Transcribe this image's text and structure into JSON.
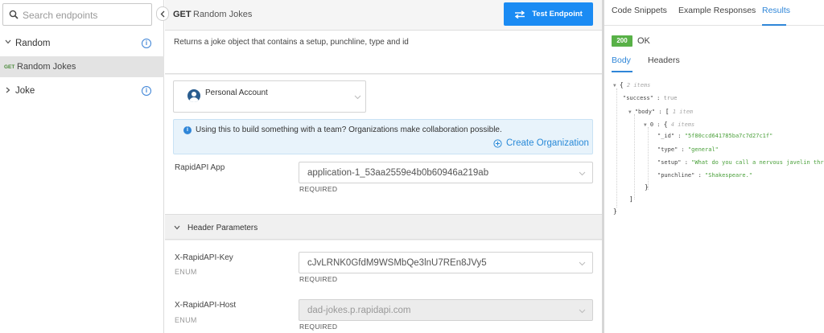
{
  "sidebar": {
    "search_placeholder": "Search endpoints",
    "groups": [
      {
        "label": "Random",
        "info": "i"
      },
      {
        "label": "Joke",
        "info": "i"
      }
    ],
    "endpoint": {
      "method": "GET",
      "name": "Random Jokes"
    }
  },
  "main": {
    "method": "GET",
    "title": "Random Jokes",
    "test_button": "Test Endpoint",
    "description": "Returns a joke object that contains a setup, punchline, type and id",
    "account": "Personal Account",
    "notice": {
      "icon": "i",
      "text": "Using this to build something with a team? Organizations make collaboration possible.",
      "link": "Create Organization"
    },
    "app": {
      "label": "RapidAPI App",
      "value": "application-1_53aa2559e4b0b60946a219ab",
      "required": "REQUIRED"
    },
    "header_params_title": "Header Parameters",
    "params": [
      {
        "label": "X-RapidAPI-Key",
        "type": "ENUM",
        "value": "cJvLRNK0GfdM9WSMbQe3lnU7REn8JVy5",
        "required": "REQUIRED"
      },
      {
        "label": "X-RapidAPI-Host",
        "type": "ENUM",
        "value": "dad-jokes.p.rapidapi.com",
        "required": "REQUIRED"
      }
    ]
  },
  "results": {
    "tabs": [
      "Code Snippets",
      "Example Responses",
      "Results"
    ],
    "active_tab": "Results",
    "status_code": "200",
    "status_text": "OK",
    "subtabs": [
      "Body",
      "Headers"
    ],
    "active_subtab": "Body",
    "json": {
      "root_open": "{",
      "root_meta": "2 items",
      "success_key": "\"success\"",
      "success_value": "true",
      "body_key": "\"body\"",
      "body_open": "[",
      "body_meta": "1 item",
      "index_key": "0",
      "item_open": "{",
      "item_meta": "4 items",
      "fields": [
        {
          "key": "\"_id\"",
          "value": "\"5f80ccd641785ba7c7d27c1f\""
        },
        {
          "key": "\"type\"",
          "value": "\"general\""
        },
        {
          "key": "\"setup\"",
          "value": "\"What do you call a nervous javelin thrower?\""
        },
        {
          "key": "\"punchline\"",
          "value": "\"Shakespeare.\""
        }
      ],
      "item_close": "}",
      "body_close": "]",
      "root_close": "}"
    }
  },
  "colors": {
    "accent": "#1a8bf3",
    "link": "#2f86d8",
    "success": "#58b147",
    "string_value": "#4aa03a"
  },
  "icons": [
    "search-icon",
    "chevron-left-icon",
    "chevron-down-icon",
    "chevron-right-icon",
    "info-icon",
    "swap-arrows-icon",
    "avatar-icon",
    "plus-circle-icon"
  ]
}
